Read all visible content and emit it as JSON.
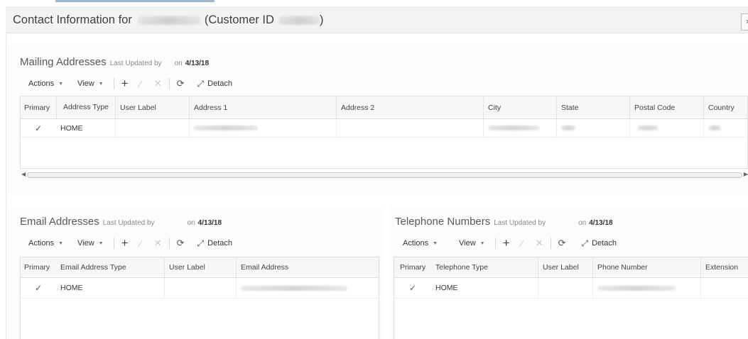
{
  "header": {
    "title_prefix": "Contact Information for",
    "title_customer_id_label": "(Customer ID",
    "title_suffix": ")",
    "close_label": "×"
  },
  "toolbar_labels": {
    "actions": "Actions",
    "view": "View",
    "detach": "Detach",
    "add_icon": "plus-icon",
    "edit_icon": "pencil-icon",
    "delete_icon": "x-icon",
    "refresh_icon": "refresh-icon",
    "detach_icon": "detach-icon"
  },
  "mailing": {
    "title": "Mailing Addresses",
    "last_updated_label": "Last Updated by",
    "on_label": "on",
    "date": "4/13/18",
    "columns": [
      "Primary",
      "Address Type",
      "User Label",
      "Address 1",
      "Address 2",
      "City",
      "State",
      "Postal Code",
      "Country"
    ],
    "rows": [
      {
        "primary": "✓",
        "type": "HOME",
        "user_label": "",
        "city": "GOUVERNEUR",
        "state": "NY",
        "postal": "13642",
        "country": "US"
      }
    ]
  },
  "email": {
    "title": "Email Addresses",
    "last_updated_label": "Last Updated by",
    "on_label": "on",
    "date": "4/13/18",
    "columns": [
      "Primary",
      "Email Address Type",
      "User Label",
      "Email Address"
    ],
    "rows": [
      {
        "primary": "✓",
        "type": "HOME",
        "user_label": ""
      }
    ]
  },
  "telephone": {
    "title": "Telephone Numbers",
    "last_updated_label": "Last Updated by",
    "on_label": "on",
    "date": "4/13/18",
    "columns": [
      "Primary",
      "Telephone Type",
      "User Label",
      "Phone Number",
      "Extension"
    ],
    "rows": [
      {
        "primary": "✓",
        "type": "HOME",
        "user_label": ""
      }
    ]
  },
  "colors": {
    "header_bg": "#f3f3f3",
    "grid_header_bg": "#f7f7f7",
    "border": "#dedede",
    "accent_line": "#9bb7d4"
  }
}
